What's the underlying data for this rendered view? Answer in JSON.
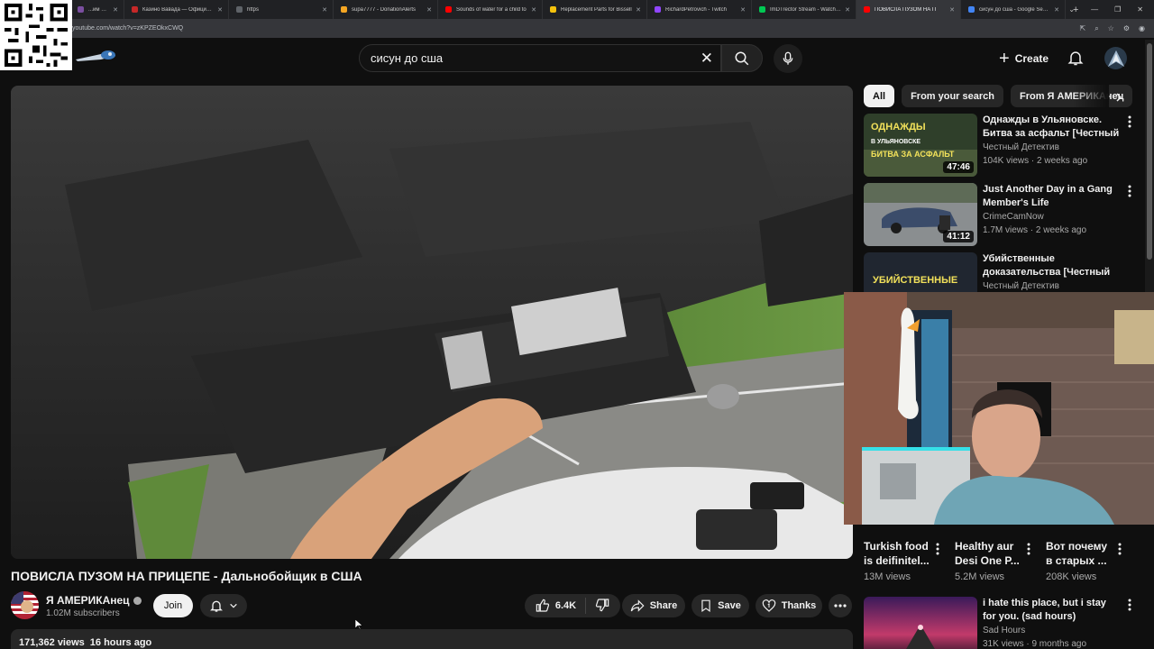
{
  "browser": {
    "tabs": [
      {
        "label": "...им онлайн-к",
        "color": "#7b4fa0"
      },
      {
        "label": "Казино Вавада — Официальн",
        "color": "#c62828"
      },
      {
        "label": "https",
        "color": "#5f6368"
      },
      {
        "label": "supa7777 - DonationAlerts",
        "color": "#f5a623"
      },
      {
        "label": "Sounds of water for a child to",
        "color": "#ff0000"
      },
      {
        "label": "Replacement Parts for Bissell",
        "color": "#f4c20d"
      },
      {
        "label": "RichardPetrovich - Twitch",
        "color": "#9146ff"
      },
      {
        "label": "ImDTrector Stream - Watch Li",
        "color": "#00c853"
      },
      {
        "label": "ПОВИСЛА ПУЗОМ НА П",
        "color": "#ff0000",
        "active": true
      },
      {
        "label": "сисун до сша - Google Search",
        "color": "#4285f4"
      }
    ],
    "url": "youtube.com/watch?v=zKPZEOkxCWQ"
  },
  "header": {
    "search_value": "сисун до сша",
    "create_label": "Create"
  },
  "video": {
    "title": "ПОВИСЛА ПУЗОМ НА ПРИЦЕПЕ - Дальнобойщик в США",
    "channel": "Я АМЕРИКАнец",
    "subscribers": "1.02M subscribers",
    "join_label": "Join",
    "likes": "6.4K",
    "share_label": "Share",
    "save_label": "Save",
    "thanks_label": "Thanks",
    "views": "171,362 views",
    "age": "16 hours ago"
  },
  "chips": [
    "All",
    "From your search",
    "From Я АМЕРИКАнец"
  ],
  "recommendations": [
    {
      "title": "Однажды в Ульяновске. Битва за асфальт [Честный ...",
      "channel": "Честный Детектив",
      "meta": "104K views · 2 weeks ago",
      "duration": "47:46"
    },
    {
      "title": "Just Another Day in a Gang Member's Life",
      "channel": "CrimeCamNow",
      "meta": "1.7M views · 2 weeks ago",
      "duration": "41:12"
    },
    {
      "title": "Убийственные доказательства [Честный ...",
      "channel": "Честный Детектив",
      "meta": "",
      "duration": ""
    },
    {
      "title": "i hate this place, but i stay for you. (sad hours)",
      "channel": "Sad Hours",
      "meta": "31K views · 9 months ago",
      "duration": ""
    }
  ],
  "thumb_texts": {
    "rec1": "ОДНАЖДЫ В УЛЬЯНОВСКЕ БИТВА ЗА АСФАЛЬТ",
    "rec3": "УБИЙСТВЕННЫЕ"
  },
  "shorts": [
    {
      "title": "Turkish food is deifinitel...",
      "views": "13M views"
    },
    {
      "title": "Healthy aur Desi One P...",
      "views": "5.2M views"
    },
    {
      "title": "Вот почему в старых ...",
      "views": "208K views"
    }
  ],
  "icons": [
    "qr-code",
    "youtube-logo",
    "search-icon",
    "clear-icon",
    "mic-icon",
    "plus-icon",
    "bell-icon",
    "like-icon",
    "dislike-icon",
    "share-icon",
    "save-icon",
    "thanks-icon",
    "more-icon",
    "chevron-right-icon"
  ]
}
